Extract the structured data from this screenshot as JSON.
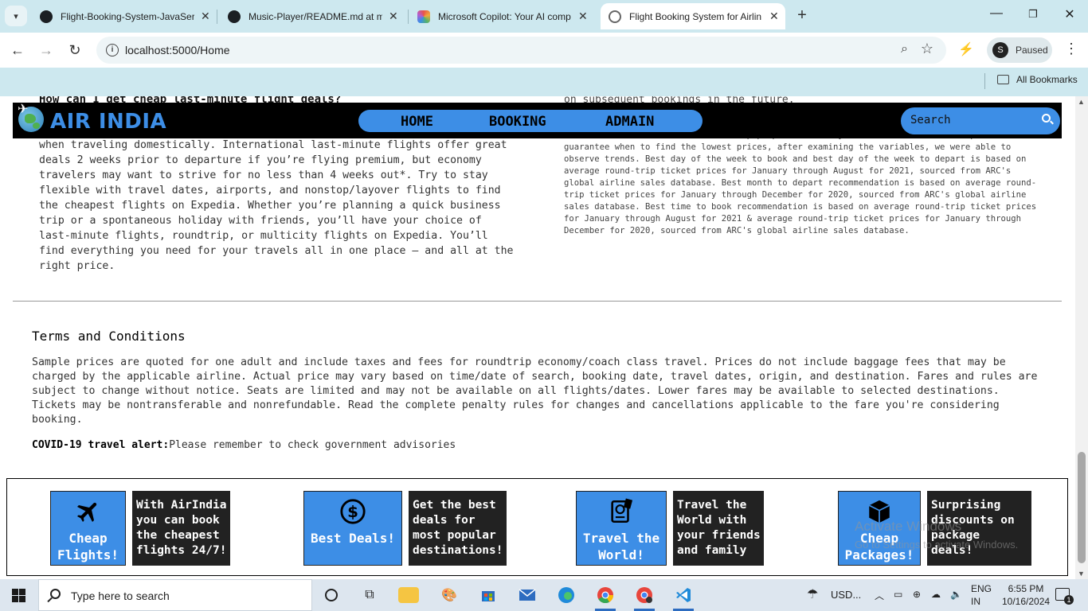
{
  "browser": {
    "tabs": [
      {
        "title": "Flight-Booking-System-JavaSer",
        "favicon": "github-icon"
      },
      {
        "title": "Music-Player/README.md at m",
        "favicon": "github-icon"
      },
      {
        "title": "Microsoft Copilot: Your AI comp",
        "favicon": "copilot-icon"
      },
      {
        "title": "Flight Booking System for Airlin",
        "favicon": "globe-icon",
        "active": true
      }
    ],
    "url": "localhost:5000/Home",
    "profile_status": "Paused",
    "profile_initial": "S",
    "bookmarks_folder": "All Bookmarks"
  },
  "site": {
    "brand": "AIR INDIA",
    "nav": [
      "HOME",
      "BOOKING",
      "ADMAIN"
    ],
    "search_placeholder": "Search"
  },
  "faq": {
    "question_partial": "How can I get cheap last-minute flight deals?",
    "answer": "when traveling domestically. International last-minute flights offer great deals 2 weeks prior to departure if you’re flying premium, but economy travelers may want to strive for no less than 4 weeks out*. Try to stay flexible with travel dates, airports, and nonstop/layover flights to find the cheapest flights on Expedia. Whether you’re planning a quick business trip or a spontaneous holiday with friends, you’ll have your choice of last-minute flights, roundtrip, or multicity flights on Expedia. You’ll find everything you need for your travels all in one place — and all at the right price.",
    "right_top": "on subsequent bookings in the future.",
    "right_body": "distil actionable information to help people save money on travel. While it's impossible to guarantee when to find the lowest prices, after examining the variables, we were able to observe trends. Best day of the week to book and best day of the week to depart is based on average round-trip ticket prices for January through August for 2021, sourced from ARC's global airline sales database. Best month to depart recommendation is based on average round-trip ticket prices for January through December for 2020, sourced from ARC's global airline sales database. Best time to book recommendation is based on average round-trip ticket prices for January through August for 2021 & average round-trip ticket prices for January through December for 2020, sourced from ARC's global airline sales database."
  },
  "terms": {
    "title": "Terms and Conditions",
    "body": "Sample prices are quoted for one adult and include taxes and fees for roundtrip economy/coach class travel. Prices do not include baggage fees that may be charged by the applicable airline. Actual price may vary based on time/date of search, booking date, travel dates, origin, and destination. Fares and rules are subject to change without notice. Seats are limited and may not be available on all flights/dates. Lower fares may be available to selected destinations. Tickets may be nontransferable and nonrefundable. Read the complete penalty rules for changes and cancellations applicable to the fare you're considering booking.",
    "covid_label": "COVID-19 travel alert:",
    "covid_text": "Please remember to check government advisories"
  },
  "features": [
    {
      "title": "Cheap Flights!",
      "desc": "With AirIndia you can book the cheapest flights 24/7!",
      "icon": "airplane-icon"
    },
    {
      "title": "Best Deals!",
      "desc": "Get the best deals for most popular destinations!",
      "icon": "dollar-icon"
    },
    {
      "title": "Travel the World!",
      "desc": "Travel the World with your friends and family",
      "icon": "passport-icon"
    },
    {
      "title": "Cheap Packages!",
      "desc": "Surprising discounts on package deals!",
      "icon": "package-icon"
    }
  ],
  "watermark": {
    "line1": "Activate Windows",
    "line2": "Go to Settings to activate Windows."
  },
  "taskbar": {
    "search_placeholder": "Type here to search",
    "weather": "USD...",
    "lang1": "ENG",
    "lang2": "IN",
    "time": "6:55 PM",
    "date": "10/16/2024",
    "notifications": "1"
  }
}
